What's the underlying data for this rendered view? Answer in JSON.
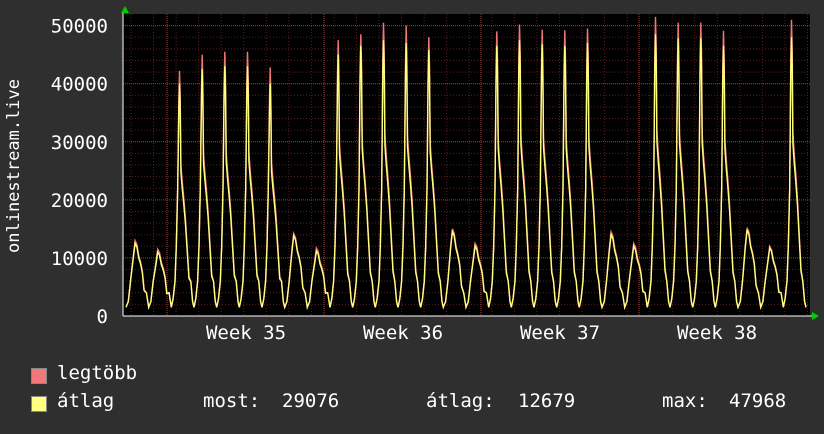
{
  "chart_data": {
    "type": "area",
    "ylabel": "onlinestream.live",
    "ylim": [
      0,
      52000
    ],
    "y_ticks": [
      "0",
      "10000",
      "20000",
      "30000",
      "40000",
      "50000"
    ],
    "x_ticks": [
      "Week 35",
      "Week 36",
      "Week 37",
      "Week 38"
    ],
    "grid": true,
    "legend_placement": "bottom-left",
    "colors": {
      "background": "#2f2f2f",
      "plot_background": "#000000",
      "grid_minor": "#5a1f1f",
      "grid_major": "#a04040",
      "axis": "#ffffff",
      "legtobb": "#f07878",
      "atlag": "#ffff80"
    },
    "series": [
      {
        "name": "legtöbb",
        "color": "#f07878"
      },
      {
        "name": "átlag",
        "color": "#ffff80"
      }
    ],
    "daily_peaks": {
      "legtobb": [
        13000,
        11500,
        42200,
        45000,
        45500,
        45500,
        42800,
        14200,
        11700,
        47500,
        48500,
        50500,
        50000,
        48000,
        15000,
        12500,
        49000,
        50200,
        49300,
        49200,
        49500,
        14500,
        12500,
        51500,
        50500,
        50500,
        49100,
        15200,
        12000,
        51000
      ],
      "atlag": [
        12500,
        11000,
        40000,
        42500,
        43000,
        43000,
        40000,
        13800,
        11200,
        45000,
        46500,
        47500,
        47000,
        45800,
        14500,
        12000,
        46500,
        47500,
        46800,
        46500,
        47000,
        14000,
        12000,
        48500,
        47800,
        47800,
        46500,
        14800,
        11700,
        47968
      ]
    },
    "summary": {
      "most_label": "most:",
      "most_value": "29076",
      "atlag_label": "átlag:",
      "atlag_value": "12679",
      "max_label": "max:",
      "max_value": "47968"
    }
  }
}
